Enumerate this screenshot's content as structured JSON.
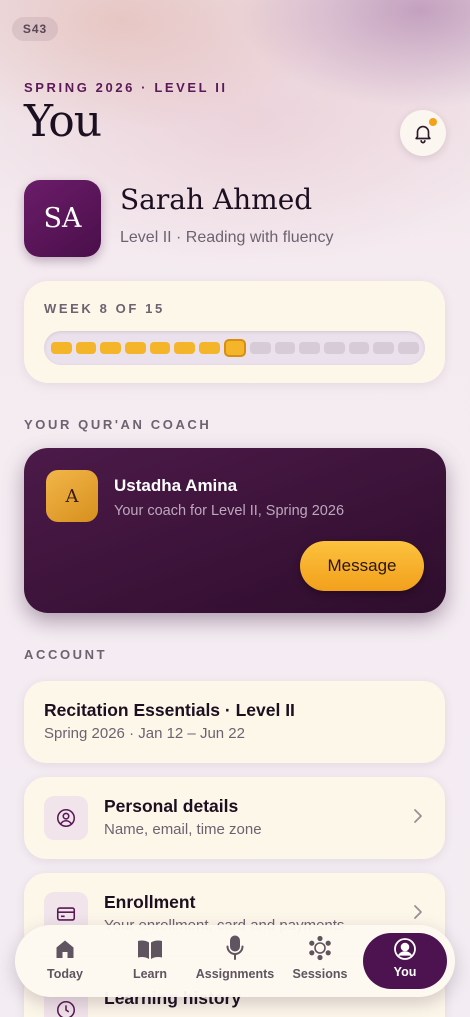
{
  "status": {
    "chip": "S43"
  },
  "header": {
    "eyebrow": "SPRING 2026 · LEVEL II",
    "title": "You",
    "bell_icon": "bell-icon",
    "has_notification": true
  },
  "profile": {
    "initials": "SA",
    "name": "Sarah Ahmed",
    "subtitle": "Level II · Reading with fluency"
  },
  "progress": {
    "label": "WEEK 8 OF 15",
    "current_week": 8,
    "total_weeks": 15
  },
  "coach": {
    "section_label": "YOUR QUR'AN COACH",
    "initial": "A",
    "name": "Ustadha Amina",
    "subtitle": "Your coach for Level II, Spring 2026",
    "message_label": "Message"
  },
  "account": {
    "section_label": "ACCOUNT",
    "course": {
      "title": "Recitation Essentials · Level II",
      "subtitle": "Spring 2026 · Jan 12 – Jun 22"
    },
    "rows": [
      {
        "title": "Personal details",
        "subtitle": "Name, email, time zone",
        "icon": "person-circle-icon"
      },
      {
        "title": "Enrollment",
        "subtitle": "Your enrollment, card and payments",
        "icon": "card-icon"
      },
      {
        "title": "Learning history",
        "subtitle": "",
        "icon": "clock-icon"
      }
    ]
  },
  "tabs": [
    {
      "label": "Today",
      "icon": "home-icon",
      "active": false
    },
    {
      "label": "Learn",
      "icon": "book-icon",
      "active": false
    },
    {
      "label": "Assignments",
      "icon": "microphone-icon",
      "active": false
    },
    {
      "label": "Sessions",
      "icon": "sessions-icon",
      "active": false
    },
    {
      "label": "You",
      "icon": "profile-icon",
      "active": true
    }
  ],
  "colors": {
    "brand_plum": "#4d1250",
    "accent_gold": "#f4b52a",
    "card_cream": "#fdf7ea"
  }
}
